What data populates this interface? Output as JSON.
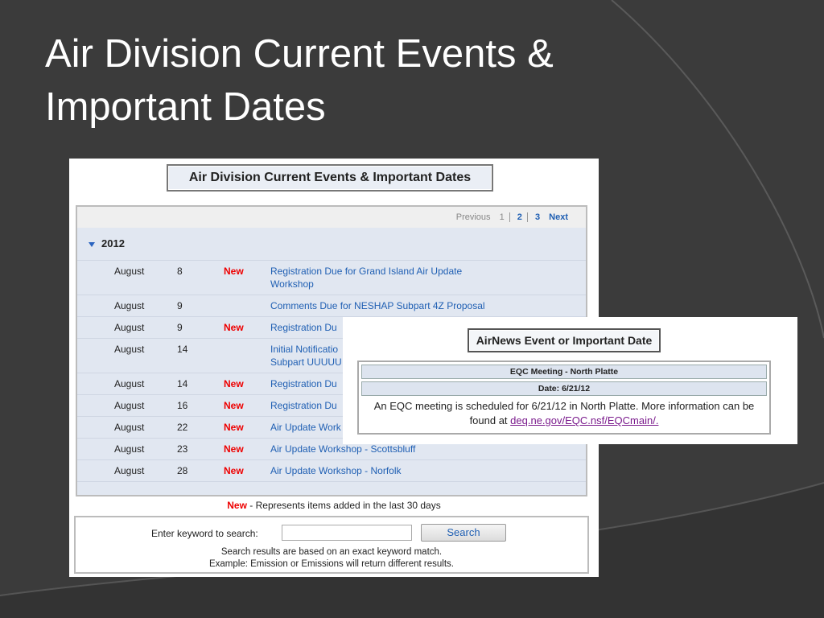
{
  "slide": {
    "title_line1": "Air Division Current Events &",
    "title_line2": "Important Dates"
  },
  "page": {
    "header": "Air Division Current Events & Important Dates",
    "pagination": {
      "previous": "Previous",
      "pages": [
        "1",
        "2",
        "3"
      ],
      "next": "Next"
    },
    "year": "2012",
    "events": [
      {
        "month": "August",
        "day": "8",
        "badge": "New",
        "title": "Registration Due for Grand Island Air Update Workshop"
      },
      {
        "month": "August",
        "day": "9",
        "badge": "",
        "title": "Comments Due for NESHAP Subpart 4Z Proposal"
      },
      {
        "month": "August",
        "day": "9",
        "badge": "New",
        "title": "Registration Du"
      },
      {
        "month": "August",
        "day": "14",
        "badge": "",
        "title": "Initial Notificatio Subpart UUUUU"
      },
      {
        "month": "August",
        "day": "14",
        "badge": "New",
        "title": "Registration Du"
      },
      {
        "month": "August",
        "day": "16",
        "badge": "New",
        "title": "Registration Du"
      },
      {
        "month": "August",
        "day": "22",
        "badge": "New",
        "title": "Air Update Work"
      },
      {
        "month": "August",
        "day": "23",
        "badge": "New",
        "title": "Air Update Workshop - Scottsbluff"
      },
      {
        "month": "August",
        "day": "28",
        "badge": "New",
        "title": "Air Update Workshop - Norfolk"
      }
    ],
    "legend_new": "New",
    "legend_text": " - Represents items added in the last 30 days",
    "search": {
      "label": "Enter keyword to search:",
      "button": "Search",
      "note_line1": "Search results are based on an exact keyword match.",
      "note_line2": "Example: Emission or Emissions will return different results."
    }
  },
  "popup": {
    "header": "AirNews Event or Important Date",
    "event_title": "EQC Meeting - North Platte",
    "event_date": "Date: 6/21/12",
    "body_text": "An EQC meeting is scheduled for 6/21/12 in North Platte. More information can be found at ",
    "link": "deq.ne.gov/EQC.nsf/EQCmain/."
  }
}
